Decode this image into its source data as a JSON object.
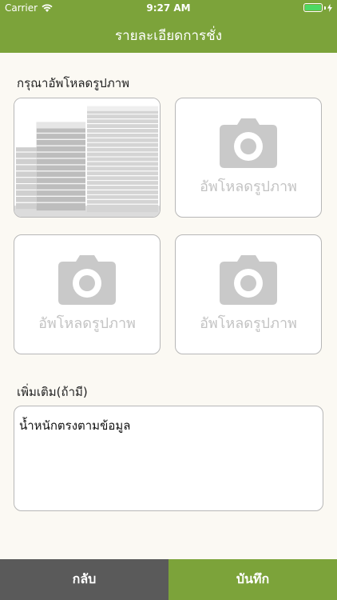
{
  "status_bar": {
    "carrier": "Carrier",
    "time": "9:27 AM"
  },
  "header": {
    "title": "รายละเอียดการชั่ง"
  },
  "upload": {
    "label": "กรุณาอัพโหลดรูปภาพ",
    "slots": [
      {
        "text": "",
        "icon": "paper-stack-photo"
      },
      {
        "text": "อัพโหลดรูปภาพ",
        "icon": "camera-icon"
      },
      {
        "text": "อัพโหลดรูปภาพ",
        "icon": "camera-icon"
      },
      {
        "text": "อัพโหลดรูปภาพ",
        "icon": "camera-icon"
      }
    ]
  },
  "extra": {
    "label": "เพิ่มเติม(ถ้ามี)",
    "value": "น้ำหนักตรงตามข้อมูล"
  },
  "footer": {
    "back_label": "กลับ",
    "save_label": "บันทึก"
  },
  "colors": {
    "accent": "#7ca33a",
    "back_button": "#5a5a5a",
    "background": "#fbf9f3"
  }
}
